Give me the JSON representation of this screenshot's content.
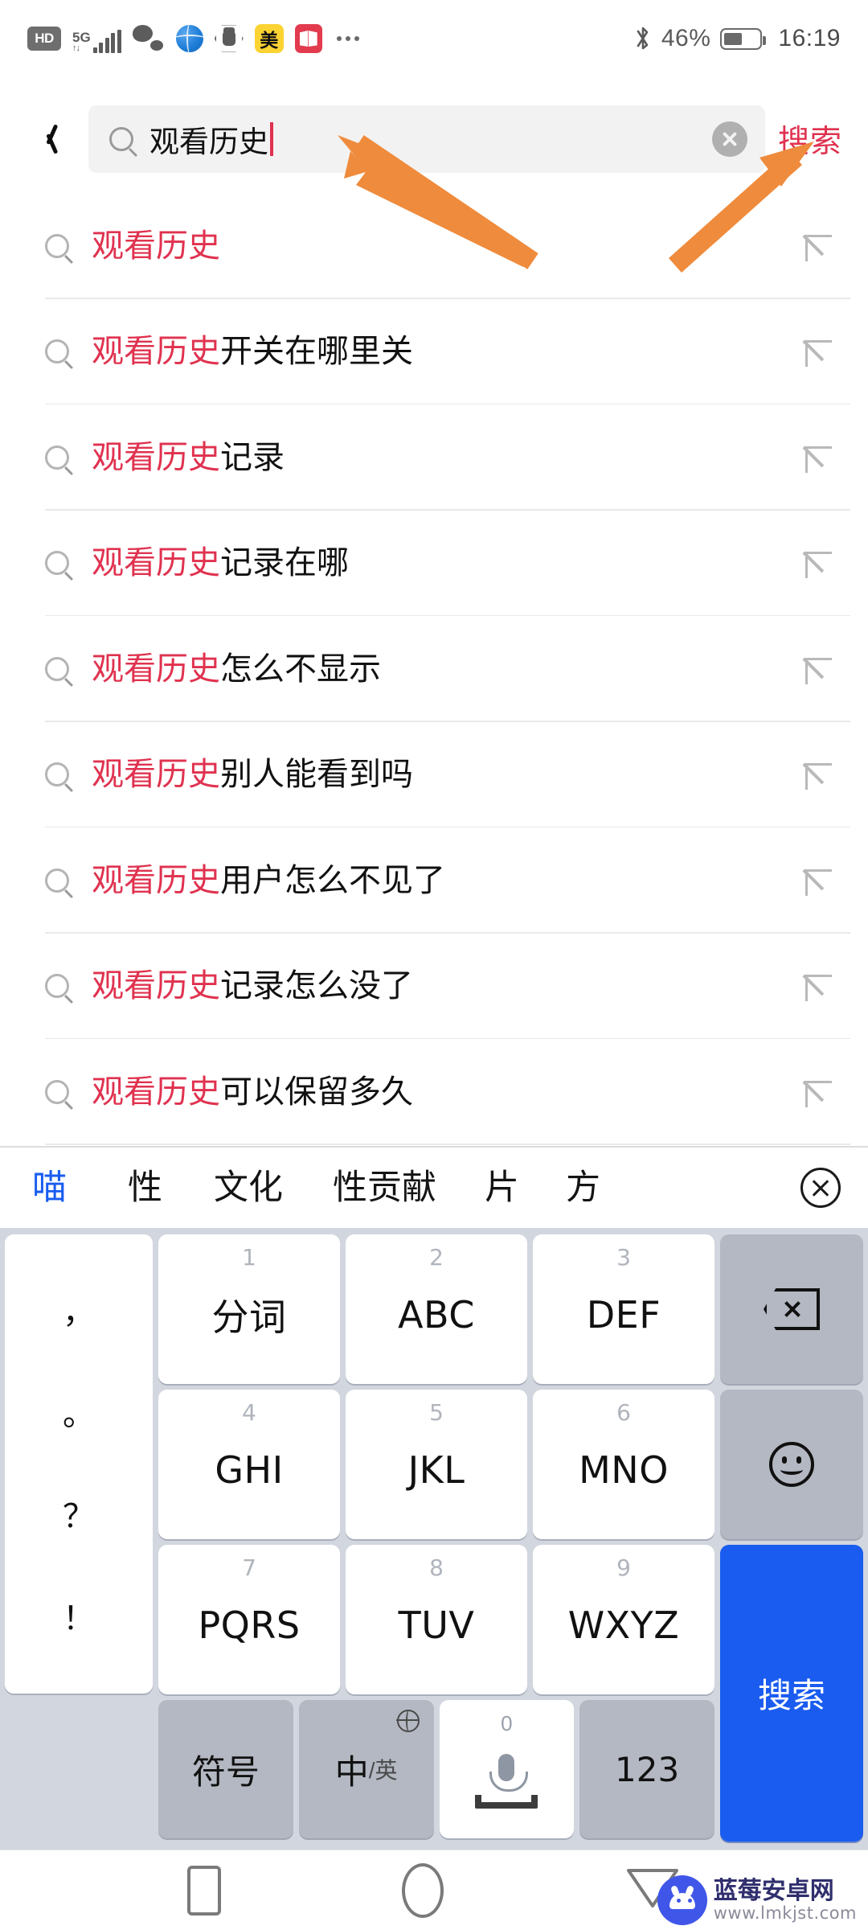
{
  "status_bar": {
    "left_icons": [
      {
        "name": "hd-icon",
        "label": "HD"
      },
      {
        "name": "signal-5g-icon",
        "label": "5G"
      },
      {
        "name": "wechat-icon",
        "label": "WeChat"
      },
      {
        "name": "browser-globe-icon",
        "label": "Browser"
      },
      {
        "name": "hand-shield-icon",
        "label": "Blocker"
      },
      {
        "name": "meituan-icon",
        "label": "美"
      },
      {
        "name": "book-app-icon",
        "label": "Reader"
      },
      {
        "name": "more-icons-ellipsis",
        "label": "…"
      }
    ],
    "bluetooth_label": "Bluetooth",
    "battery_percent": "46%",
    "time": "16:19"
  },
  "search": {
    "back_label": "Back",
    "query": "观看历史",
    "placeholder": "搜索",
    "clear_label": "清除",
    "action_label": "搜索",
    "accent_color": "#e0324f"
  },
  "suggestions": [
    {
      "highlight": "观看历史",
      "rest": ""
    },
    {
      "highlight": "观看历史",
      "rest": "开关在哪里关"
    },
    {
      "highlight": "观看历史",
      "rest": "记录"
    },
    {
      "highlight": "观看历史",
      "rest": "记录在哪"
    },
    {
      "highlight": "观看历史",
      "rest": "怎么不显示"
    },
    {
      "highlight": "观看历史",
      "rest": "别人能看到吗"
    },
    {
      "highlight": "观看历史",
      "rest": "用户怎么不见了"
    },
    {
      "highlight": "观看历史",
      "rest": "记录怎么没了"
    },
    {
      "highlight": "观看历史",
      "rest": "可以保留多久"
    }
  ],
  "keyboard": {
    "candidates": [
      "喵",
      "性",
      "文化",
      "性贡献",
      "片",
      "方"
    ],
    "candidate_active_index": 0,
    "candidate_close_label": "关闭",
    "punct_key": [
      "，",
      "。",
      "？",
      "！"
    ],
    "rows": [
      [
        {
          "num": "1",
          "label": "分词"
        },
        {
          "num": "2",
          "label": "ABC"
        },
        {
          "num": "3",
          "label": "DEF"
        }
      ],
      [
        {
          "num": "4",
          "label": "GHI"
        },
        {
          "num": "5",
          "label": "JKL"
        },
        {
          "num": "6",
          "label": "MNO"
        }
      ],
      [
        {
          "num": "7",
          "label": "PQRS"
        },
        {
          "num": "8",
          "label": "TUV"
        },
        {
          "num": "9",
          "label": "WXYZ"
        }
      ]
    ],
    "backspace_label": "退格",
    "emoji_label": "表情",
    "search_key_label": "搜索",
    "bottom": {
      "symbol_label": "符号",
      "lang_main": "中",
      "lang_sub": "/英",
      "space_num": "0",
      "space_label": "空格",
      "numeric_label": "123"
    },
    "accent_blue": "#1a5cf0"
  },
  "nav_bar": {
    "recent_label": "最近任务",
    "home_label": "主页",
    "back_label": "返回"
  },
  "watermark": {
    "name": "蓝莓安卓网",
    "url": "www.lmkjst.com"
  }
}
